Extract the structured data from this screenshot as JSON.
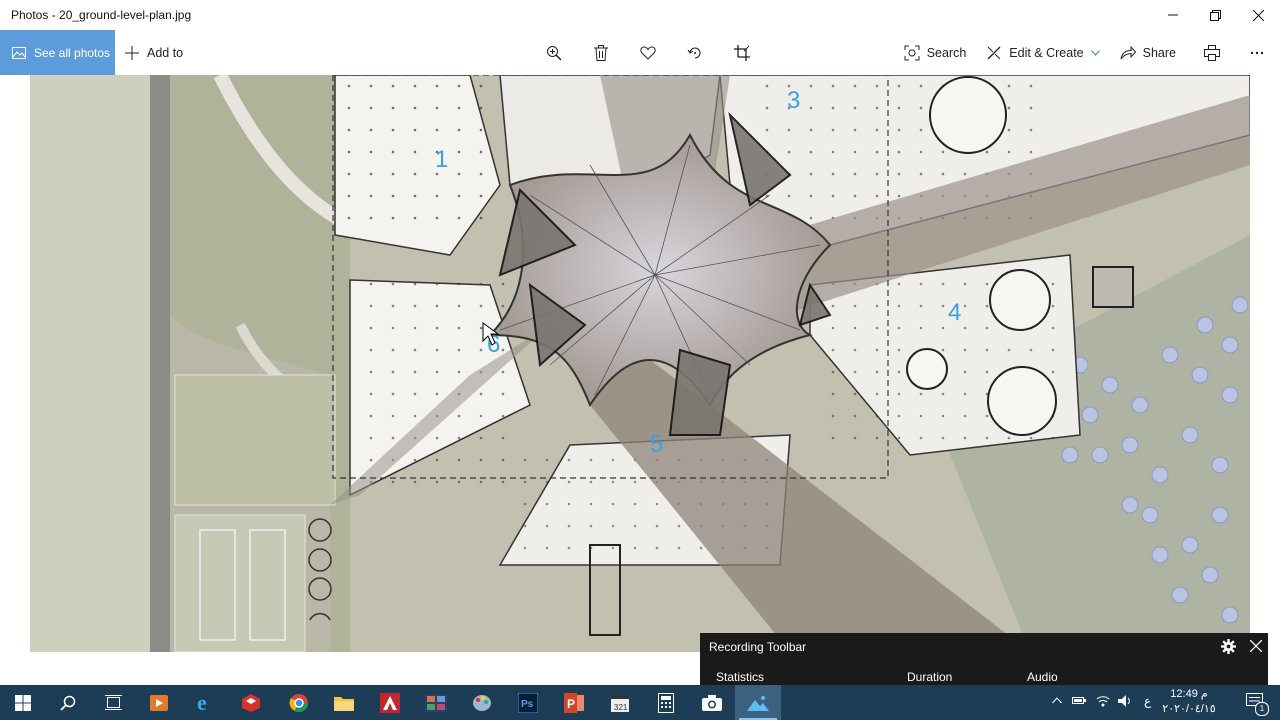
{
  "window": {
    "title": "Photos - 20_ground-level-plan.jpg"
  },
  "toolbar": {
    "see_all_label": "See all photos",
    "add_to_label": "Add to",
    "search_label": "Search",
    "edit_create_label": "Edit & Create",
    "share_label": "Share",
    "center_icons": [
      "zoom-icon",
      "delete-icon",
      "favorite-icon",
      "rotate-icon",
      "crop-icon"
    ]
  },
  "plan": {
    "labels": [
      "1",
      "3",
      "4",
      "5",
      "6"
    ]
  },
  "recording": {
    "title": "Recording Toolbar",
    "statistics_label": "Statistics",
    "duration_label": "Duration",
    "audio_label": "Audio"
  },
  "taskbar": {
    "time": "12:49 م",
    "date": "٢٠٢٠/٠٤/١٥",
    "lang": "ع",
    "notification_count": "1",
    "apps": [
      "start",
      "search",
      "task-view",
      "media",
      "edge",
      "sketchup",
      "chrome",
      "explorer",
      "autocad",
      "photos-gallery",
      "paint",
      "photoshop",
      "powerpoint",
      "clapper",
      "calculator",
      "camera",
      "photos"
    ]
  },
  "colors": {
    "accent": "#5d9cdb",
    "taskbar": "#1d3d56",
    "number_labels": "#3aa0e0"
  }
}
